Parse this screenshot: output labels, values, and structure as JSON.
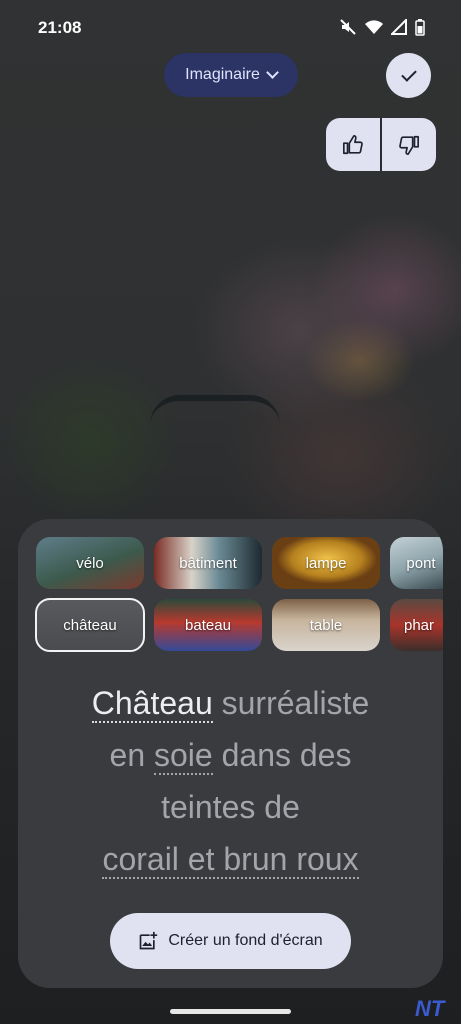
{
  "status_bar": {
    "time": "21:08"
  },
  "style_selector": {
    "label": "Imaginaire"
  },
  "chips_row1": [
    {
      "label": "vélo",
      "selected": false
    },
    {
      "label": "bâtiment",
      "selected": false
    },
    {
      "label": "lampe",
      "selected": false
    },
    {
      "label": "pont",
      "selected": false
    }
  ],
  "chips_row2": [
    {
      "label": "château",
      "selected": true
    },
    {
      "label": "bateau",
      "selected": false
    },
    {
      "label": "table",
      "selected": false
    },
    {
      "label": "phar",
      "selected": false
    }
  ],
  "prompt": {
    "subject": "Château",
    "after_subject": " surréaliste",
    "line2_start": "en ",
    "material": "soie",
    "line2_end": " dans des",
    "line3": "teintes de",
    "colors": "corail et brun roux"
  },
  "create_button": {
    "label": "Créer un fond d'écran"
  },
  "watermark": "NT"
}
